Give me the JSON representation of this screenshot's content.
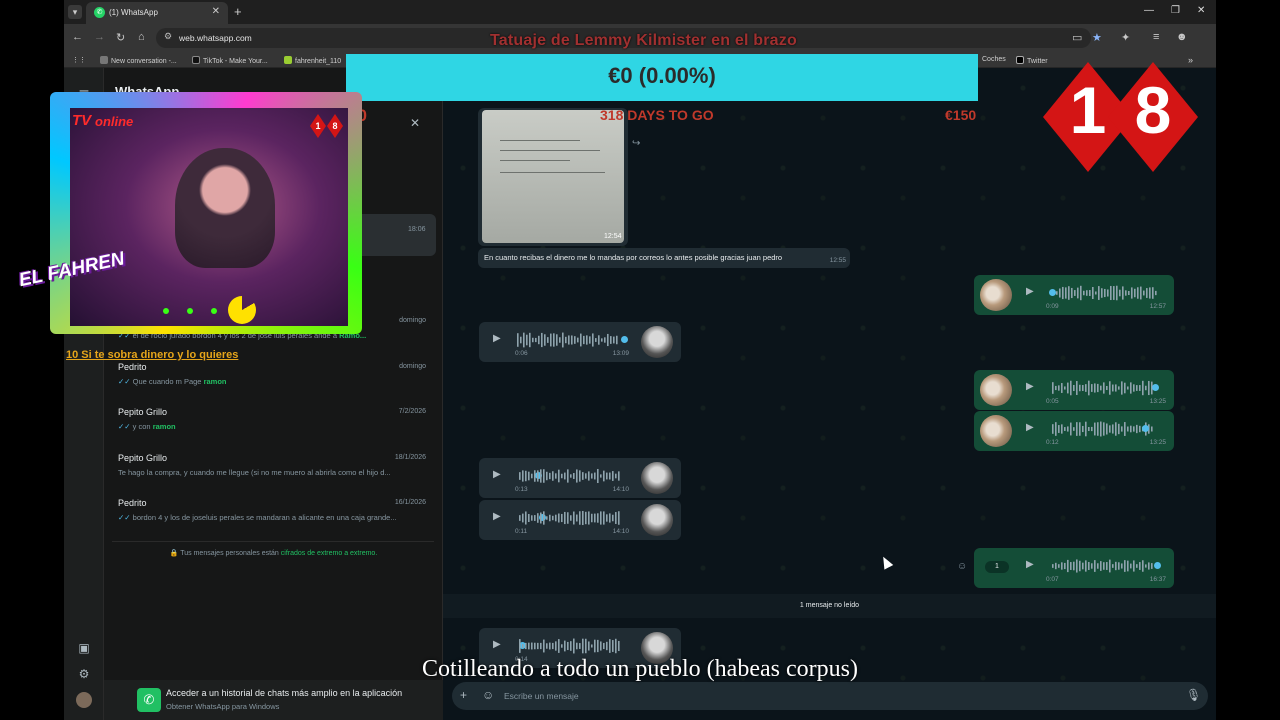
{
  "browser": {
    "tab_title": "(1) WhatsApp",
    "url": "web.whatsapp.com",
    "bookmarks": [
      "New conversation -...",
      "TikTok - Make Your...",
      "fahrenheit_110",
      "Coches",
      "Twitter"
    ]
  },
  "whatsapp": {
    "app_title": "WhatsApp",
    "chats": [
      {
        "name": "",
        "date": "18:06",
        "preview": ""
      },
      {
        "name": "",
        "date": "domingo",
        "preview": "el de rocio jurado bordon 4 y los 2 de jose luis perales",
        "preview_tail": "ande a",
        "preview_hl": "Ramo..."
      },
      {
        "name": "Pedrito",
        "date": "domingo",
        "preview": "Que cuando m Page",
        "preview_hl": "ramon"
      },
      {
        "name": "Pepito Grillo",
        "date": "7/2/2026",
        "preview": "y con",
        "preview_hl": "ramon"
      },
      {
        "name": "Pepito Grillo",
        "date": "18/1/2026",
        "preview": "Te hago la compra, y cuando me llegue (si no me muero al abrirla como el hijo d..."
      },
      {
        "name": "Pedrito",
        "date": "16/1/2026",
        "preview": "bordon 4 y los de joseluis perales se mandaran a alicante en una caja grande..."
      }
    ],
    "e2e_text": "Tus mensajes personales están",
    "e2e_link": "cifrados de extremo a extremo.",
    "banner_title": "Acceder a un historial de chats más amplio en la aplicación",
    "banner_subtitle": "Obtener WhatsApp para Windows",
    "messages": {
      "image_time": "12:54",
      "text": "En cuanto recibas el dinero me lo mandas por correos lo antes posible gracias juan pedro",
      "text_time": "12:55",
      "voice": [
        {
          "dir": "out",
          "dur": "0:09",
          "time": "12:57"
        },
        {
          "dir": "in",
          "dur": "0:06",
          "time": "13:09"
        },
        {
          "dir": "out",
          "dur": "0:05",
          "time": "13:25"
        },
        {
          "dir": "out",
          "dur": "0:12",
          "time": "13:25"
        },
        {
          "dir": "in",
          "dur": "0:13",
          "time": "14:10"
        },
        {
          "dir": "in",
          "dur": "0:11",
          "time": "14:10"
        },
        {
          "dir": "out",
          "dur": "0:07",
          "time": "16:37",
          "speed": "1"
        },
        {
          "dir": "in",
          "dur": "0:14",
          "time": ""
        }
      ]
    },
    "unread_label": "1 mensaje no leído",
    "composer_placeholder": "Escribe un mensaje"
  },
  "overlay": {
    "title": "Tatuaje de Lemmy Kilmister en el brazo",
    "progress_text": "€0 (0.00%)",
    "progress_fraction": 0.0,
    "raised": "€0",
    "days_left": "318 DAYS TO GO",
    "goal": "€150",
    "badge_digits": [
      "1",
      "8"
    ],
    "cam_label_tv": "TV",
    "cam_label_online": "online",
    "brand_text": "EL FAHREN",
    "ticker": "10 Si te sobra dinero y lo quieres",
    "subtitle": "Cotilleando a todo un pueblo  (habeas corpus)",
    "colors": {
      "bar": "#2fd6e4",
      "badge": "#d41515",
      "whatsapp_green": "#21c063",
      "outgoing_bubble": "#144d37"
    }
  }
}
